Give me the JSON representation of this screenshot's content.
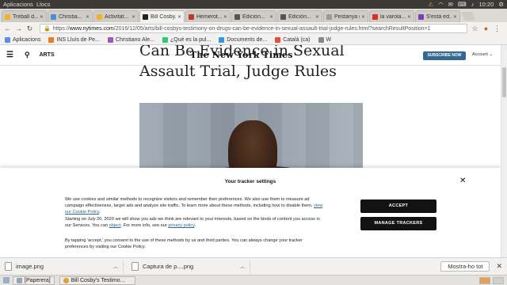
{
  "os": {
    "menu": [
      "Aplicacions",
      "Llocs"
    ],
    "clock": "10:20"
  },
  "tabs": [
    {
      "label": "Treball d...",
      "color": "#f2b32a"
    },
    {
      "label": "Christia...",
      "color": "#4a8fd6"
    },
    {
      "label": "Activitat...",
      "color": "#f2b32a"
    },
    {
      "label": "Bill Cosby...",
      "color": "#222222"
    },
    {
      "label": "Hemerot...",
      "color": "#c0392b"
    },
    {
      "label": "Edición...",
      "color": "#555555"
    },
    {
      "label": "Edición...",
      "color": "#555555"
    },
    {
      "label": "Pestanya nova",
      "color": "#999999"
    },
    {
      "label": "la varola...",
      "color": "#d93025"
    },
    {
      "label": "S'està ed...",
      "color": "#7b3fb5"
    }
  ],
  "browser": {
    "url_prefix": "https://",
    "url_host": "www.nytimes.com",
    "url_path": "/2016/12/05/arts/bill-cosbys-testimony-on-drugs-can-be-evidence-in-sexual-assault-trial-judge-rules.html?searchResultPosition=1"
  },
  "bookmarks": [
    {
      "label": "Aplicacions",
      "color": "#5b8def"
    },
    {
      "label": "INS Lluís de Pe...",
      "color": "#e67e22"
    },
    {
      "label": "Christiano Ale...",
      "color": "#9b59b6"
    },
    {
      "label": "¿Qué es la pul...",
      "color": "#2ecc71"
    },
    {
      "label": "Documents de...",
      "color": "#3498db"
    },
    {
      "label": "Català (ca)",
      "color": "#e74c3c"
    },
    {
      "label": "W",
      "color": "#888888"
    }
  ],
  "nyt": {
    "section": "ARTS",
    "logo": "The New York Times",
    "subscribe": "SUBSCRIBE NOW",
    "account": "Account ⌄",
    "headline_1": "Can Be Evidence in Sexual",
    "headline_2": "Assault Trial, Judge Rules"
  },
  "cookie": {
    "title": "Your tracker settings",
    "p1": "We use cookies and similar methods to recognize visitors and remember their preferences. We also use them to measure ad campaign effectiveness, target ads and analyze site traffic. To learn more about these methods, including how to disable them, ",
    "p1_link": "view our Cookie Policy",
    "p2a": "Starting on July 20, 2020 we will show you ads we think are relevant to your interests, based on the kinds of content you access in our Services. You can ",
    "p2_link1": "object",
    "p2b": ". For more info, see our ",
    "p2_link2": "privacy policy",
    "p3": "By tapping 'accept,' you consent to the use of these methods by us and third parties. You can always change your tracker preferences by visiting our Cookie Policy.",
    "accept": "ACCEPT",
    "manage": "MANAGE TRACKERS"
  },
  "downloads": {
    "items": [
      "image.png",
      "Captura de p....png"
    ],
    "show_all": "Mostra-ho tot"
  },
  "taskbar": {
    "items": [
      "[Paperera]",
      "Bill Cosby's Testimo..."
    ]
  }
}
